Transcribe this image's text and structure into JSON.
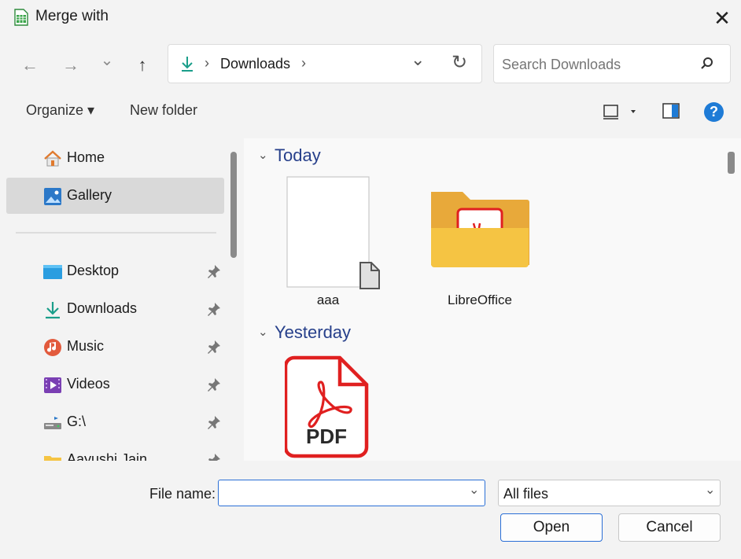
{
  "window": {
    "title": "Merge with",
    "close_glyph": "✕"
  },
  "nav": {
    "back": "←",
    "forward": "→",
    "recent": "⌄",
    "up": "↑"
  },
  "address": {
    "folder": "Downloads",
    "separator": "›",
    "trailing_separator": "›",
    "dropdown": "⌄",
    "refresh": "↻"
  },
  "search": {
    "placeholder": "Search Downloads"
  },
  "toolbar": {
    "organize": "Organize ▾",
    "new_folder": "New folder",
    "help": "?"
  },
  "sidebar": {
    "items": [
      {
        "label": "Home",
        "icon": "home-icon"
      },
      {
        "label": "Gallery",
        "icon": "gallery-icon",
        "selected": true
      },
      {
        "label": "Desktop",
        "icon": "desktop-icon",
        "pinned": true
      },
      {
        "label": "Downloads",
        "icon": "downloads-icon",
        "pinned": true
      },
      {
        "label": "Music",
        "icon": "music-icon",
        "pinned": true
      },
      {
        "label": "Videos",
        "icon": "videos-icon",
        "pinned": true
      },
      {
        "label": "G:\\",
        "icon": "drive-icon",
        "pinned": true
      },
      {
        "label": "Aayushi Jain",
        "icon": "folder-icon",
        "pinned": true
      }
    ]
  },
  "groups": [
    {
      "header": "Today",
      "items": [
        {
          "label": "aaa",
          "icon": "document-icon"
        },
        {
          "label": "LibreOffice",
          "icon": "folder-icon"
        }
      ]
    },
    {
      "header": "Yesterday",
      "items": [
        {
          "label": "",
          "icon": "pdf-icon",
          "badge": "PDF"
        }
      ]
    }
  ],
  "footer": {
    "file_name_label": "File name:",
    "file_name_value": "",
    "file_type": "All files",
    "open": "Open",
    "cancel": "Cancel"
  },
  "colors": {
    "accent": "#0067c0",
    "group_header": "#27408b",
    "pdf_red": "#e02020",
    "folder_yellow": "#f5c443"
  }
}
